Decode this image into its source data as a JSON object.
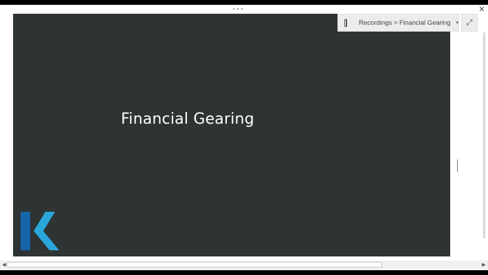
{
  "breadcrumb": {
    "text": "Recordings > Financial Gearing",
    "caret": "▾"
  },
  "slide": {
    "title": "Financial Gearing",
    "background": "#2d3433",
    "title_color": "#ffffff"
  },
  "logo": {
    "letter": "K",
    "colors": {
      "dark": "#1565a8",
      "light": "#2aa6db"
    }
  },
  "controls": {
    "expand_icon": "⤢",
    "close_icon": "✕",
    "scroll_left_icon": "◀",
    "scroll_right_icon": "▶"
  }
}
